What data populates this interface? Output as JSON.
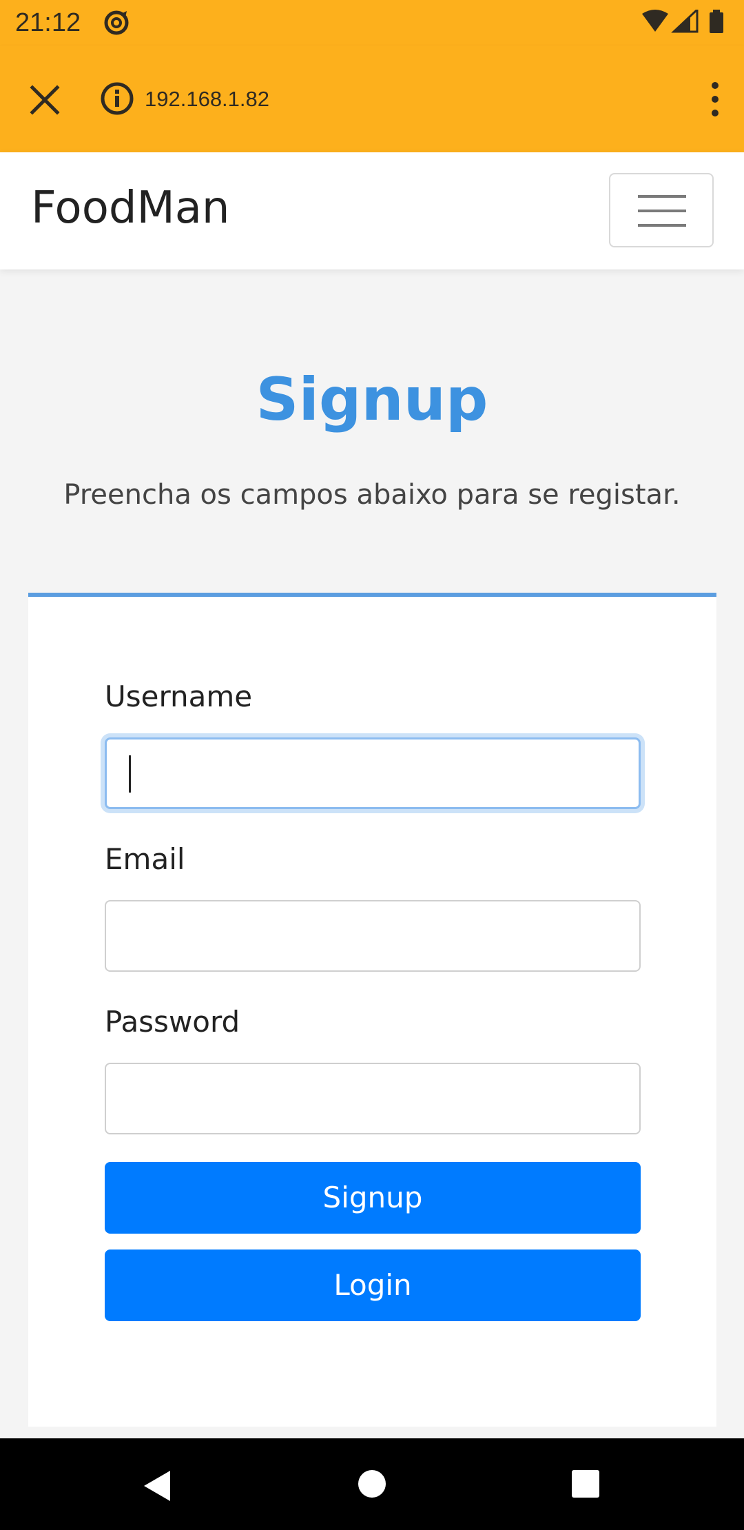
{
  "status_bar": {
    "time": "21:12",
    "icons": [
      "sync-icon",
      "wifi-icon",
      "signal-icon",
      "battery-icon"
    ]
  },
  "browser": {
    "url": "192.168.1.82",
    "icons": [
      "close-icon",
      "info-icon",
      "overflow-menu-icon"
    ]
  },
  "navbar": {
    "brand": "FoodMan",
    "toggle_icon": "hamburger-icon"
  },
  "header": {
    "title": "Signup",
    "subtitle": "Preencha os campos abaixo para se registar."
  },
  "form": {
    "username_label": "Username",
    "username_value": "",
    "email_label": "Email",
    "email_value": "",
    "password_label": "Password",
    "password_value": "",
    "signup_button": "Signup",
    "login_button": "Login"
  },
  "colors": {
    "browser_bar": "#fdb01c",
    "title": "#3d92e0",
    "card_accent": "#5b9de0",
    "button": "#007bff"
  },
  "system_nav": [
    "back-icon",
    "home-icon",
    "recents-icon"
  ]
}
